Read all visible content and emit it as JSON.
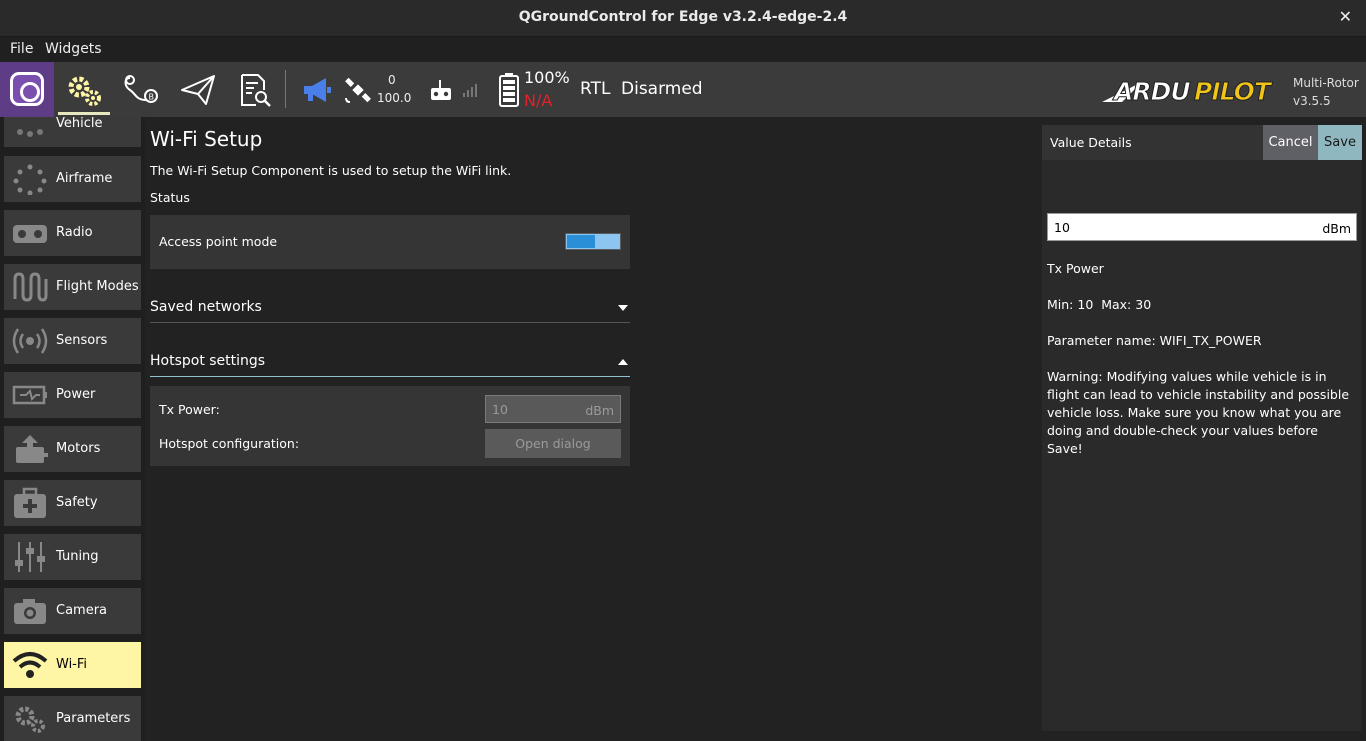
{
  "window": {
    "title": "QGroundControl for Edge v3.2.4-edge-2.4",
    "close_glyph": "✕"
  },
  "menu": {
    "items": [
      "File",
      "Widgets"
    ]
  },
  "toolbar": {
    "gps_count": "0",
    "gps_hdop": "100.0",
    "battery_percent": "100%",
    "battery_voltage": "N/A",
    "flight_mode": "RTL",
    "arm_state": "Disarmed",
    "brand": "ARDUPILOT",
    "vehicle_type": "Multi-Rotor",
    "firmware_version": "v3.5.5",
    "accent_color": "#fef6a4",
    "warning_color": "#e0222b",
    "icons": [
      "qgc-logo-icon",
      "gears-icon",
      "plan-route-icon",
      "fly-plane-icon",
      "analyze-icon",
      "megaphone-icon",
      "satellite-icon",
      "rc-transmitter-icon",
      "signal-bars-icon",
      "battery-icon"
    ]
  },
  "sidebar": {
    "items": [
      {
        "label": "Vehicle",
        "icon": "vehicle-icon"
      },
      {
        "label": "Airframe",
        "icon": "airframe-icon"
      },
      {
        "label": "Radio",
        "icon": "radio-icon"
      },
      {
        "label": "Flight Modes",
        "icon": "flight-modes-icon"
      },
      {
        "label": "Sensors",
        "icon": "sensors-icon"
      },
      {
        "label": "Power",
        "icon": "power-icon"
      },
      {
        "label": "Motors",
        "icon": "motors-icon"
      },
      {
        "label": "Safety",
        "icon": "safety-icon"
      },
      {
        "label": "Tuning",
        "icon": "tuning-icon"
      },
      {
        "label": "Camera",
        "icon": "camera-icon"
      },
      {
        "label": "Wi-Fi",
        "icon": "wifi-icon"
      },
      {
        "label": "Parameters",
        "icon": "parameters-icon"
      }
    ],
    "active": "Wi-Fi"
  },
  "wifi": {
    "title": "Wi-Fi Setup",
    "description": "The Wi-Fi Setup Component is used to setup the WiFi link.",
    "status_label": "Status",
    "access_point_label": "Access point mode",
    "access_point_enabled": true,
    "saved_networks_label": "Saved networks",
    "hotspot_settings_label": "Hotspot settings",
    "tx_power_label": "Tx Power:",
    "tx_power_value": "10",
    "tx_power_unit": "dBm",
    "hotspot_config_label": "Hotspot configuration:",
    "open_dialog_label": "Open dialog"
  },
  "details": {
    "title": "Value Details",
    "cancel_label": "Cancel",
    "save_label": "Save",
    "value": "10",
    "unit": "dBm",
    "param_desc": "Tx Power",
    "range": "Min: 10  Max: 30",
    "param_name": "Parameter name: WIFI_TX_POWER",
    "warning": "Warning: Modifying values while vehicle is in flight can lead to vehicle instability and possible vehicle loss. Make sure you know what you are doing and double-check your values before Save!"
  }
}
